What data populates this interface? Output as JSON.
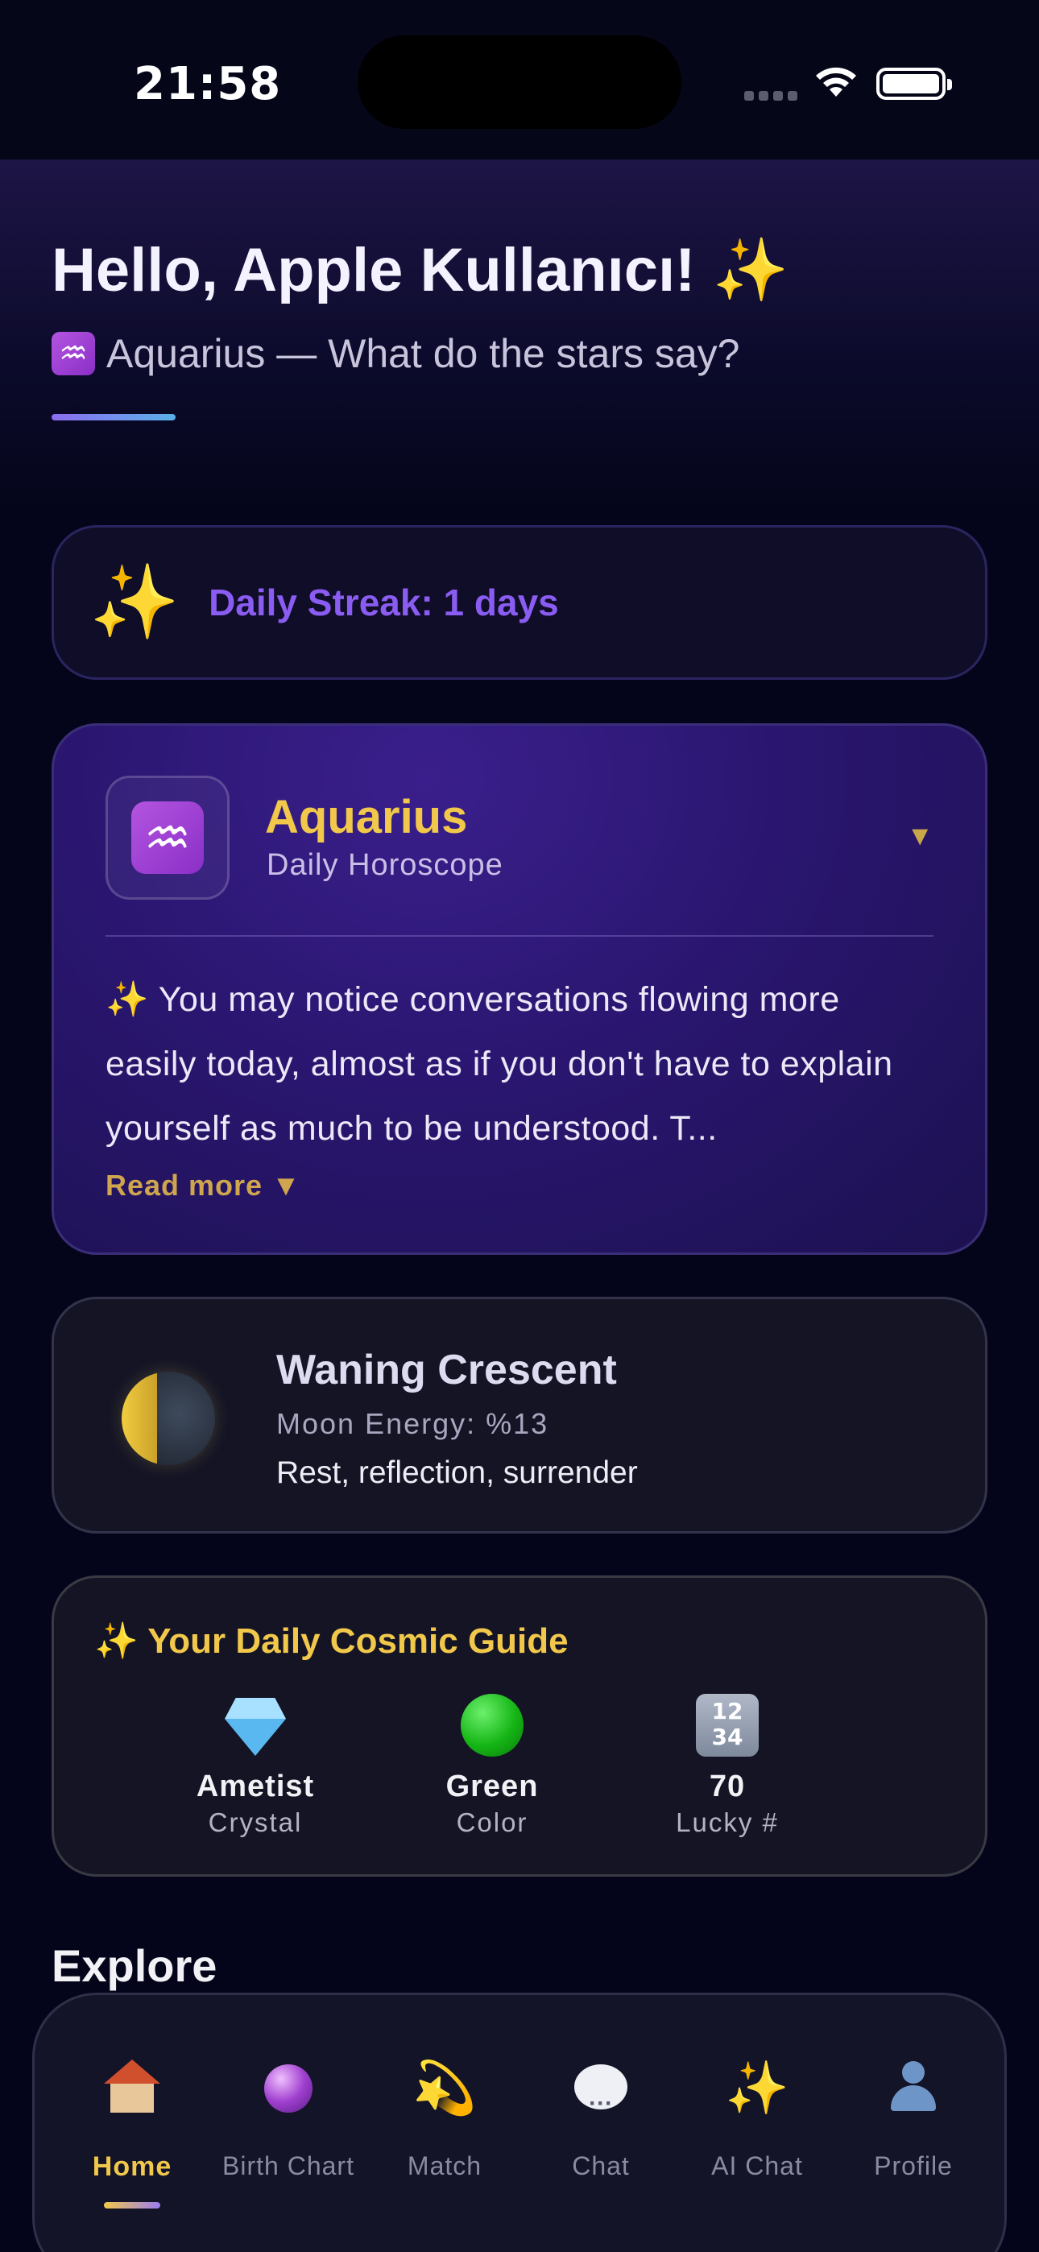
{
  "status_bar": {
    "time": "21:58"
  },
  "header": {
    "greeting": "Hello, Apple Kullanıcı! ✨",
    "sign_glyph": "♒",
    "subtitle": "Aquarius — What do the stars say?"
  },
  "streak": {
    "icon": "sparkles-icon",
    "label": "Daily Streak: 1 days"
  },
  "horoscope": {
    "sign_glyph": "♒",
    "sign": "Aquarius",
    "subtitle": "Daily Horoscope",
    "text": "✨ You may notice conversations flowing more easily today, almost as if you don't have to explain yourself as much to be understood. T...",
    "read_more": "Read more ▼",
    "collapse_icon": "▼"
  },
  "moon": {
    "phase": "Waning Crescent",
    "energy": "Moon Energy: %13",
    "description": "Rest, reflection, surrender"
  },
  "guide": {
    "title": "✨ Your Daily Cosmic Guide",
    "items": [
      {
        "value": "Ametist",
        "label": "Crystal",
        "icon": "gem-icon"
      },
      {
        "value": "Green",
        "label": "Color",
        "icon": "green-circle-icon"
      },
      {
        "value": "70",
        "label": "Lucky #",
        "icon": "numbers-icon",
        "tile_top": "12",
        "tile_bottom": "34"
      }
    ]
  },
  "explore": {
    "title": "Explore"
  },
  "tabs": [
    {
      "label": "Home",
      "icon": "house-icon",
      "active": true
    },
    {
      "label": "Birth Chart",
      "icon": "crystal-ball-icon"
    },
    {
      "label": "Match",
      "icon": "dizzy-star-icon"
    },
    {
      "label": "Chat",
      "icon": "speech-bubble-icon"
    },
    {
      "label": "AI Chat",
      "icon": "sparkles-icon"
    },
    {
      "label": "Profile",
      "icon": "person-icon"
    }
  ],
  "colors": {
    "background": "#04051a",
    "accent_gold": "#f2c84b",
    "accent_purple": "#8a5cf2"
  }
}
